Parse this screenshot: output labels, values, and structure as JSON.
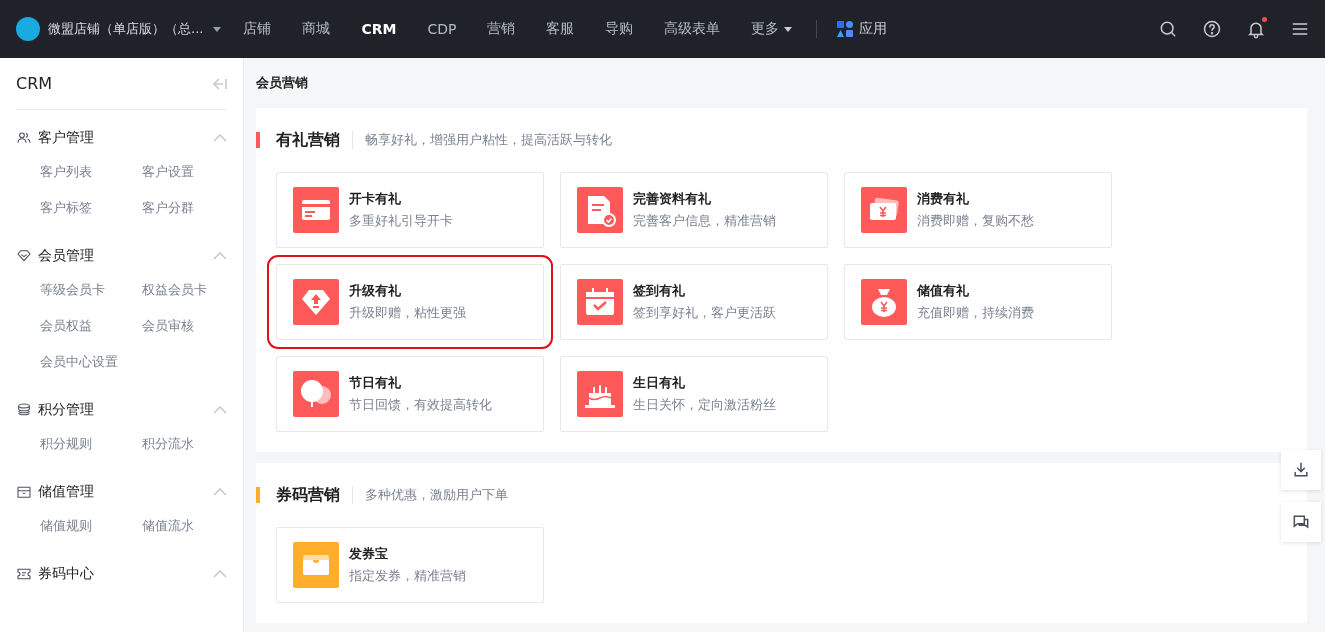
{
  "top_bar": {
    "store_name": "微盟店铺（单店版）（总...",
    "nav": [
      {
        "label": "店铺",
        "selected": false,
        "kind": "link"
      },
      {
        "label": "商城",
        "selected": false,
        "kind": "link"
      },
      {
        "label": "CRM",
        "selected": true,
        "kind": "link"
      },
      {
        "label": "CDP",
        "selected": false,
        "kind": "link"
      },
      {
        "label": "营销",
        "selected": false,
        "kind": "link"
      },
      {
        "label": "客服",
        "selected": false,
        "kind": "link"
      },
      {
        "label": "导购",
        "selected": false,
        "kind": "link"
      },
      {
        "label": "高级表单",
        "selected": false,
        "kind": "link"
      },
      {
        "label": "更多",
        "selected": false,
        "kind": "dropdown"
      }
    ],
    "apps_label": "应用",
    "notification_unread": true
  },
  "sidebar": {
    "title": "CRM",
    "groups": [
      {
        "label": "客户管理",
        "expanded": true,
        "items": [
          "客户列表",
          "客户设置",
          "客户标签",
          "客户分群"
        ]
      },
      {
        "label": "会员管理",
        "expanded": true,
        "items": [
          "等级会员卡",
          "权益会员卡",
          "会员权益",
          "会员审核",
          "会员中心设置"
        ]
      },
      {
        "label": "积分管理",
        "expanded": true,
        "items": [
          "积分规则",
          "积分流水"
        ]
      },
      {
        "label": "储值管理",
        "expanded": true,
        "items": [
          "储值规则",
          "储值流水"
        ]
      },
      {
        "label": "券码中心",
        "expanded": true
      }
    ]
  },
  "breadcrumb": "会员营销",
  "sections": [
    {
      "title": "有礼营销",
      "subtitle": "畅享好礼，增强用户粘性，提高活跃与转化",
      "color": "#ff5a5a",
      "cards": [
        {
          "title": "开卡有礼",
          "desc": "多重好礼引导开卡",
          "highlighted": false
        },
        {
          "title": "完善资料有礼",
          "desc": "完善客户信息，精准营销",
          "highlighted": false
        },
        {
          "title": "消费有礼",
          "desc": "消费即赠，复购不愁",
          "highlighted": false
        },
        {
          "title": "升级有礼",
          "desc": "升级即赠，粘性更强",
          "highlighted": true
        },
        {
          "title": "签到有礼",
          "desc": "签到享好礼，客户更活跃",
          "highlighted": false
        },
        {
          "title": "储值有礼",
          "desc": "充值即赠，持续消费",
          "highlighted": false
        },
        {
          "title": "节日有礼",
          "desc": "节日回馈，有效提高转化",
          "highlighted": false
        },
        {
          "title": "生日有礼",
          "desc": "生日关怀，定向激活粉丝",
          "highlighted": false
        }
      ]
    },
    {
      "title": "券码营销",
      "subtitle": "多种优惠，激励用户下单",
      "color": "#ffad2a",
      "cards": [
        {
          "title": "发券宝",
          "desc": "指定发券，精准营销",
          "highlighted": false
        }
      ]
    }
  ]
}
